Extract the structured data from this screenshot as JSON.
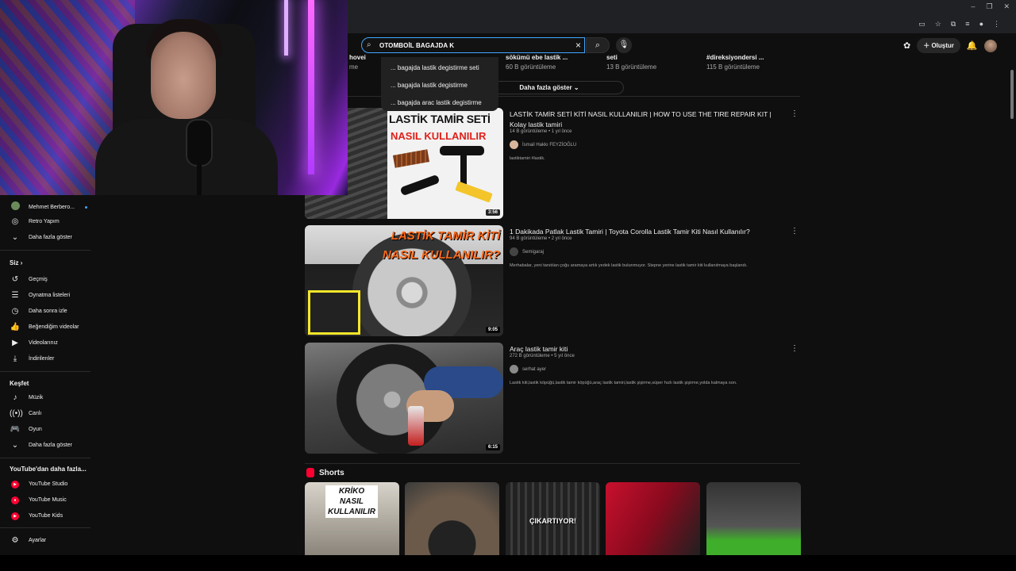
{
  "window": {
    "minimize": "–",
    "restore": "❐",
    "close": "✕"
  },
  "header": {
    "search_value": "OTOMBOİL BAGAJDA K",
    "create_label": "Oluştur"
  },
  "suggestions": [
    "... bagajda lastik degistirme seti",
    "... bagajda lastik degistirme",
    "... bagajda arac lastik degistirme"
  ],
  "prev_row": {
    "items": [
      {
        "title": "sökümü ebe lastik ...",
        "meta": "60 B görüntüleme"
      },
      {
        "title": "seti",
        "meta": "13 B görüntüleme"
      },
      {
        "title": "#direksiyondersi ...",
        "meta": "115 B görüntüleme"
      }
    ],
    "partial_left_title": "hovei",
    "partial_left_meta": "me",
    "show_more": "Daha fazla göster"
  },
  "results": [
    {
      "title": "LASTİK TAMİR SETİ KİTİ NASIL KULLANILIR | HOW TO USE THE TIRE REPAIR KIT | Kolay lastik tamiri",
      "meta": "14 B görüntüleme • 1 yıl önce",
      "channel": "İsmail Hakkı FEYZİOĞLU",
      "desc": "lastiktamiri #lastik.",
      "duration": "3:56",
      "thumb_title": "LASTİK TAMİR SETİ",
      "thumb_sub": "NASIL KULLANILIR"
    },
    {
      "title": "1 Dakikada Patlak Lastik Tamiri | Toyota Corolla Lastik Tamir Kiti Nasıl Kullanılır?",
      "meta": "94 B görüntüleme • 2 yıl önce",
      "channel": "Semigaraj",
      "desc": "Merhabalar, yeni tanıtılan çoğu aramaya artık yedek lastik bulunmuyor. Stepne yerine lastik tamir kiti kullanılmaya başlandı.",
      "duration": "9:05",
      "thumb_title": "LASTİK TAMİR KİTİ NASIL KULLANILIR?"
    },
    {
      "title": "Araç lastik tamir kiti",
      "meta": "272 B görüntüleme • 5 yıl önce",
      "channel": "serhat ayer",
      "desc": "Lastik kiti,lastik köpüğü,lastik tamir köpüğü,araç lastik tamiri,lastik şişirme,süper hızlı lastik şişirme,yolda kalmaya son.",
      "duration": "6:15"
    }
  ],
  "shorts": {
    "heading": "Shorts",
    "s1_label": "KRİKO NASIL KULLANILIR",
    "s3_label": "ÇIKARTIYOR!"
  },
  "sidebar": {
    "subs": [
      {
        "label": "Mehmet Berbero...",
        "icon": "avatar"
      },
      {
        "label": "Retro Yapım",
        "icon": "avatar"
      },
      {
        "label": "Daha fazla göster",
        "icon": "chevron-down-icon"
      }
    ],
    "you_heading": "Siz",
    "you_items": [
      {
        "label": "Geçmiş",
        "icon": "history-icon"
      },
      {
        "label": "Oynatma listeleri",
        "icon": "playlist-icon"
      },
      {
        "label": "Daha sonra izle",
        "icon": "clock-icon"
      },
      {
        "label": "Beğendiğim videolar",
        "icon": "thumbs-up-icon"
      },
      {
        "label": "Videolarınız",
        "icon": "video-icon"
      },
      {
        "label": "İndirilenler",
        "icon": "download-icon"
      }
    ],
    "explore_heading": "Keşfet",
    "explore_items": [
      {
        "label": "Müzik",
        "icon": "music-icon"
      },
      {
        "label": "Canlı",
        "icon": "live-icon"
      },
      {
        "label": "Oyun",
        "icon": "gaming-icon"
      },
      {
        "label": "Daha fazla göster",
        "icon": "chevron-down-icon"
      }
    ],
    "more_heading": "YouTube'dan daha fazla...",
    "more_items": [
      {
        "label": "YouTube Studio"
      },
      {
        "label": "YouTube Music"
      },
      {
        "label": "YouTube Kids"
      }
    ],
    "settings": "Ayarlar"
  },
  "colors": {
    "accent": "#3ea6ff",
    "brand": "#ff0033",
    "bg": "#0f0f0f"
  }
}
